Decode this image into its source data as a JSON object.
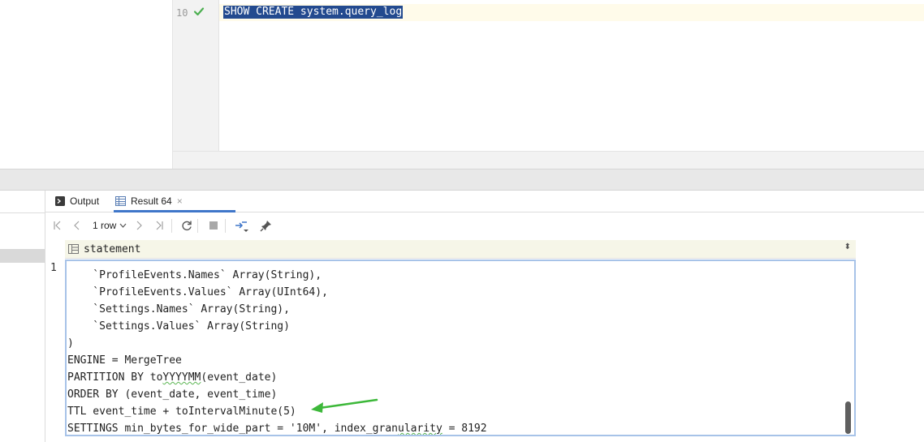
{
  "editor": {
    "line_number": "10",
    "sql": "SHOW CREATE system.query_log"
  },
  "tabs": {
    "output_label": "Output",
    "result_label": "Result 64",
    "close_label": "×"
  },
  "toolbar": {
    "rows_label": "1 row"
  },
  "grid": {
    "column_header": "statement",
    "row_number": "1",
    "lines": [
      "    `ProfileEvents.Names` Array(String),",
      "    `ProfileEvents.Values` Array(UInt64),",
      "    `Settings.Names` Array(String),",
      "    `Settings.Values` Array(String)",
      ")",
      "ENGINE = MergeTree",
      "PARTITION BY toYYYYMM(event_date)",
      "ORDER BY (event_date, event_time)",
      "TTL event_time + toIntervalMinute(5)",
      "SETTINGS min_bytes_for_wide_part = '10M', index_granularity = 8192"
    ],
    "partition_prefix": "PARTITION BY to",
    "partition_squiggle": "YYYYMM",
    "partition_suffix": "(event_date)",
    "last_prefix": "SETTINGS min_bytes_for_wide_part = '10M', index_gran",
    "last_squiggle": "ularity",
    "last_suffix": " = 8192"
  },
  "colors": {
    "selection": "#234a8f",
    "accent": "#3f76c9",
    "arrow": "#3db83a",
    "check": "#4caf50"
  }
}
